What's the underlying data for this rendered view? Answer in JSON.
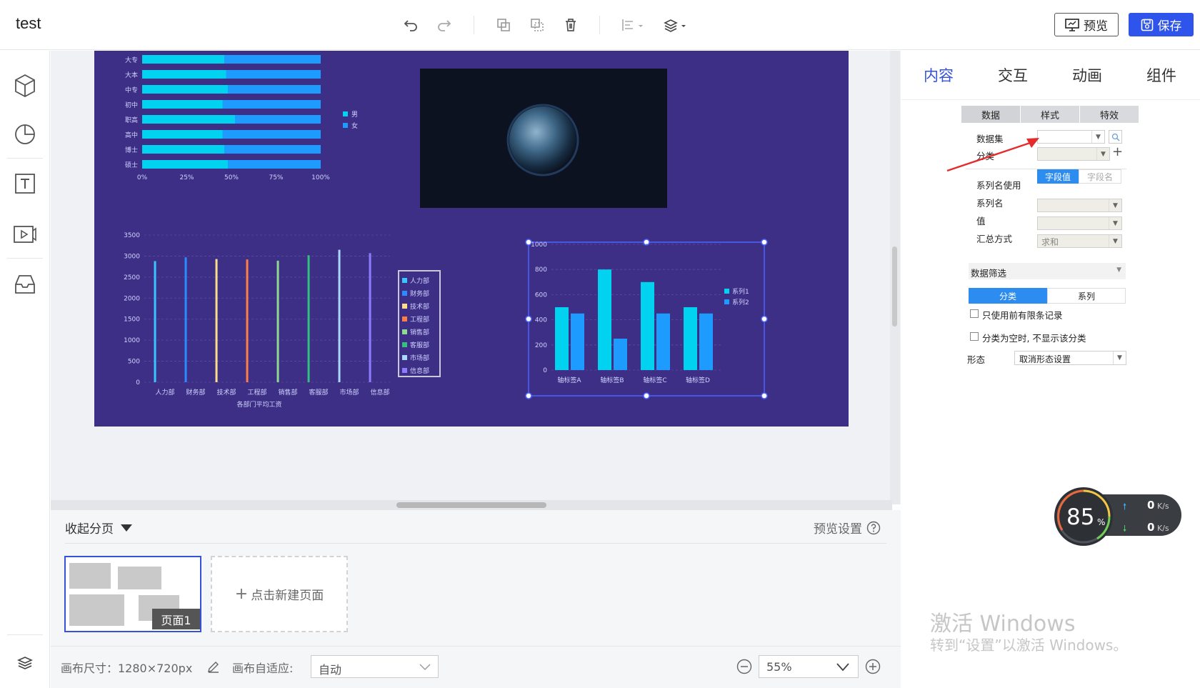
{
  "app": {
    "title": "test"
  },
  "toolbar": {
    "icons": [
      "undo-icon",
      "redo-icon",
      "copy-icon",
      "paste-icon",
      "delete-icon",
      "align-icon",
      "layer-icon"
    ],
    "preview_label": "预览",
    "save_label": "保存"
  },
  "left_sidebar": {
    "icons": [
      "cube-icon",
      "pie-chart-icon",
      "text-icon",
      "video-icon",
      "inbox-icon",
      "layers-icon"
    ]
  },
  "canvas": {
    "bg_color": "#3e2f86",
    "bar_chart_h": {
      "categories": [
        "大专",
        "大本",
        "中专",
        "初中",
        "职高",
        "高中",
        "博士",
        "硕士"
      ],
      "legend": [
        "男",
        "女"
      ],
      "ticks": [
        "0%",
        "25%",
        "50%",
        "75%",
        "100%"
      ]
    },
    "bar_chart_v": {
      "yticks": [
        "3500",
        "3000",
        "2500",
        "2000",
        "1500",
        "1000",
        "500",
        "0"
      ],
      "categories": [
        "人力部",
        "财务部",
        "技术部",
        "工程部",
        "销售部",
        "客服部",
        "市场部",
        "信息部"
      ],
      "legend": [
        "人力部",
        "财务部",
        "技术部",
        "工程部",
        "销售部",
        "客服部",
        "市场部",
        "信息部"
      ],
      "title": "各部门平均工资"
    },
    "bar_chart_sel": {
      "yticks": [
        "1000",
        "800",
        "600",
        "400",
        "200",
        "0"
      ],
      "categories": [
        "轴标签A",
        "轴标签B",
        "轴标签C",
        "轴标签D"
      ],
      "legend": [
        "系列1",
        "系列2"
      ]
    }
  },
  "chart_data": [
    {
      "type": "bar",
      "orientation": "horizontal",
      "stacked": true,
      "categories": [
        "大专",
        "大本",
        "中专",
        "初中",
        "职高",
        "高中",
        "博士",
        "硕士"
      ],
      "series": [
        {
          "name": "男",
          "values": [
            46,
            47,
            48,
            45,
            52,
            45,
            46,
            48
          ]
        },
        {
          "name": "女",
          "values": [
            54,
            53,
            52,
            55,
            48,
            55,
            54,
            52
          ]
        }
      ],
      "xlim": [
        0,
        100
      ],
      "x_tick_labels": [
        "0%",
        "25%",
        "50%",
        "75%",
        "100%"
      ],
      "legend": "right"
    },
    {
      "type": "bar",
      "categories": [
        "人力部",
        "财务部",
        "技术部",
        "工程部",
        "销售部",
        "客服部",
        "市场部",
        "信息部"
      ],
      "values": [
        2880,
        2970,
        2930,
        2920,
        2890,
        3020,
        3150,
        3070
      ],
      "colors": [
        "#37c7ff",
        "#2b8cff",
        "#ffdd88",
        "#ff7e46",
        "#8ddc8d",
        "#31c07e",
        "#a8d8ff",
        "#8c7cff"
      ],
      "ylim": [
        0,
        3500
      ],
      "xlabel": "各部门平均工资",
      "legend": "right"
    },
    {
      "type": "bar",
      "categories": [
        "轴标签A",
        "轴标签B",
        "轴标签C",
        "轴标签D"
      ],
      "series": [
        {
          "name": "系列1",
          "values": [
            500,
            800,
            700,
            500
          ]
        },
        {
          "name": "系列2",
          "values": [
            450,
            250,
            450,
            450
          ]
        }
      ],
      "ylim": [
        0,
        1000
      ],
      "legend": "right"
    }
  ],
  "pages": {
    "collapse_label": "收起分页",
    "preview_settings": "预览设置",
    "page1_label": "页面1",
    "new_page_label": "点击新建页面"
  },
  "bottom": {
    "canvas_size_label": "画布尺寸：1280×720px",
    "adapt_label": "画布自适应:",
    "adapt_value": "自动",
    "zoom_value": "55%"
  },
  "right_panel": {
    "tabs": [
      "内容",
      "交互",
      "动画",
      "组件"
    ],
    "subtabs": [
      "数据",
      "样式",
      "特效"
    ],
    "dataset_label": "数据集",
    "category_label": "分类",
    "series_name_use_label": "系列名使用",
    "series_name_opt1": "字段值",
    "series_name_opt2": "字段名",
    "series_name_label": "系列名",
    "value_label": "值",
    "agg_label": "汇总方式",
    "agg_value": "求和",
    "filter_label": "数据筛选",
    "filter_tab1": "分类",
    "filter_tab2": "系列",
    "check1": "只使用前有限条记录",
    "check2": "分类为空时, 不显示该分类",
    "form_label": "形态",
    "form_value": "取消形态设置"
  },
  "net_widget": {
    "cpu": "85",
    "unit": "%",
    "up": "0",
    "down": "0",
    "rate_unit": "K/s"
  },
  "watermark": {
    "line1": "激活 Windows",
    "line2": "转到“设置”以激活 Windows。"
  }
}
